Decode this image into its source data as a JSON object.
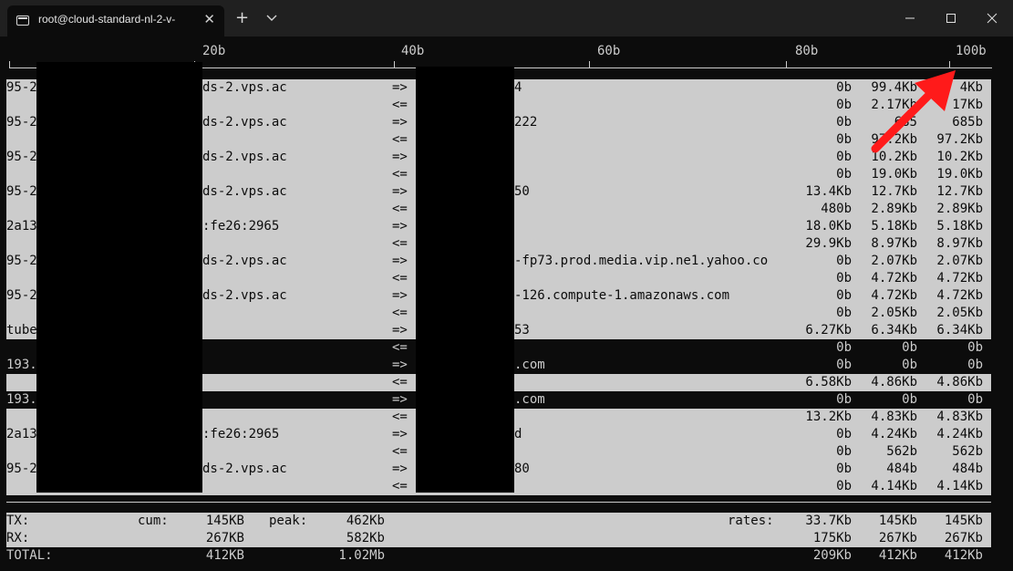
{
  "window": {
    "tab_title": "root@cloud-standard-nl-2-v-",
    "tab_close": "✕",
    "new_tab": "+"
  },
  "scale": {
    "labels": [
      "20b",
      "40b",
      "60b",
      "80b",
      "100b"
    ]
  },
  "connections": [
    {
      "host": "95-2",
      "host_tail": "ds-2.vps.ac",
      "dir": "=>",
      "peer_tail": "4",
      "r1": "0b",
      "r2": "99.4Kb",
      "r3": "4Kb"
    },
    {
      "host": "",
      "host_tail": "",
      "dir": "<=",
      "peer_tail": "",
      "r1": "0b",
      "r2": "2.17Kb",
      "r3": "17Kb"
    },
    {
      "host": "95-2",
      "host_tail": "ds-2.vps.ac",
      "dir": "=>",
      "peer_tail": "222",
      "r1": "0b",
      "r2": "685",
      "r3": "685b"
    },
    {
      "host": "",
      "host_tail": "",
      "dir": "<=",
      "peer_tail": "",
      "r1": "0b",
      "r2": "97.2Kb",
      "r3": "97.2Kb"
    },
    {
      "host": "95-2",
      "host_tail": "ds-2.vps.ac",
      "dir": "=>",
      "peer_tail": "",
      "r1": "0b",
      "r2": "10.2Kb",
      "r3": "10.2Kb"
    },
    {
      "host": "",
      "host_tail": "",
      "dir": "<=",
      "peer_tail": "",
      "r1": "0b",
      "r2": "19.0Kb",
      "r3": "19.0Kb"
    },
    {
      "host": "95-2",
      "host_tail": "ds-2.vps.ac",
      "dir": "=>",
      "peer_tail": "50",
      "r1": "13.4Kb",
      "r2": "12.7Kb",
      "r3": "12.7Kb"
    },
    {
      "host": "",
      "host_tail": "",
      "dir": "<=",
      "peer_tail": "",
      "r1": "480b",
      "r2": "2.89Kb",
      "r3": "2.89Kb"
    },
    {
      "host": "2a13",
      "host_tail": ":fe26:2965",
      "dir": "=>",
      "peer_tail": "",
      "r1": "18.0Kb",
      "r2": "5.18Kb",
      "r3": "5.18Kb"
    },
    {
      "host": "",
      "host_tail": "",
      "dir": "<=",
      "peer_tail": "",
      "r1": "29.9Kb",
      "r2": "8.97Kb",
      "r3": "8.97Kb"
    },
    {
      "host": "95-2",
      "host_tail": "ds-2.vps.ac",
      "dir": "=>",
      "peer_tail": "-fp73.prod.media.vip.ne1.yahoo.co",
      "r1": "0b",
      "r2": "2.07Kb",
      "r3": "2.07Kb"
    },
    {
      "host": "",
      "host_tail": "",
      "dir": "<=",
      "peer_tail": "",
      "r1": "0b",
      "r2": "4.72Kb",
      "r3": "4.72Kb"
    },
    {
      "host": "95-2",
      "host_tail": "ds-2.vps.ac",
      "dir": "=>",
      "peer_tail": "-126.compute-1.amazonaws.com",
      "r1": "0b",
      "r2": "4.72Kb",
      "r3": "4.72Kb"
    },
    {
      "host": "",
      "host_tail": "",
      "dir": "<=",
      "peer_tail": "",
      "r1": "0b",
      "r2": "2.05Kb",
      "r3": "2.05Kb"
    },
    {
      "host": "tube",
      "host_tail": "",
      "dir": "=>",
      "peer_tail": "53",
      "r1": "6.27Kb",
      "r2": "6.34Kb",
      "r3": "6.34Kb"
    },
    {
      "host": "",
      "host_tail": "",
      "dir": "<=",
      "peer_tail": "",
      "r1": "0b",
      "r2": "0b",
      "r3": "0b"
    },
    {
      "host": "193.",
      "host_tail": "",
      "dir": "=>",
      "peer_tail": ".com",
      "r1": "0b",
      "r2": "0b",
      "r3": "0b"
    },
    {
      "host": "",
      "host_tail": "",
      "dir": "<=",
      "peer_tail": "",
      "r1": "6.58Kb",
      "r2": "4.86Kb",
      "r3": "4.86Kb"
    },
    {
      "host": "193.",
      "host_tail": "",
      "dir": "=>",
      "peer_tail": ".com",
      "r1": "0b",
      "r2": "0b",
      "r3": "0b"
    },
    {
      "host": "",
      "host_tail": "",
      "dir": "<=",
      "peer_tail": "",
      "r1": "13.2Kb",
      "r2": "4.83Kb",
      "r3": "4.83Kb"
    },
    {
      "host": "2a13",
      "host_tail": ":fe26:2965",
      "dir": "=>",
      "peer_tail": "d",
      "r1": "0b",
      "r2": "4.24Kb",
      "r3": "4.24Kb"
    },
    {
      "host": "",
      "host_tail": "",
      "dir": "<=",
      "peer_tail": "",
      "r1": "0b",
      "r2": "562b",
      "r3": "562b"
    },
    {
      "host": "95-2",
      "host_tail": "ds-2.vps.ac",
      "dir": "=>",
      "peer_tail": "80",
      "r1": "0b",
      "r2": "484b",
      "r3": "484b"
    },
    {
      "host": "",
      "host_tail": "",
      "dir": "<=",
      "peer_tail": "",
      "r1": "0b",
      "r2": "4.14Kb",
      "r3": "4.14Kb"
    }
  ],
  "bar_fill": [
    1,
    1,
    1,
    1,
    1,
    1,
    1,
    1,
    1,
    1,
    1,
    1,
    1,
    1,
    1,
    0,
    0,
    1,
    0,
    1,
    1,
    1,
    1,
    1
  ],
  "totals": {
    "tx": {
      "label": "TX:",
      "cum_label": "cum:",
      "cum": "145KB",
      "peak_label": "peak:",
      "peak": "462Kb",
      "rates_label": "rates:",
      "r1": "33.7Kb",
      "r2": "145Kb",
      "r3": "145Kb"
    },
    "rx": {
      "label": "RX:",
      "cum": "267KB",
      "peak": "582Kb",
      "r1": "175Kb",
      "r2": "267Kb",
      "r3": "267Kb"
    },
    "total": {
      "label": "TOTAL:",
      "cum": "412KB",
      "peak": "1.02Mb",
      "r1": "209Kb",
      "r2": "412Kb",
      "r3": "412Kb"
    }
  },
  "colors": {
    "terminal_bg": "#0c0c0c",
    "text": "#cccccc",
    "bar": "#cccccc",
    "annotation_arrow": "#ff1a1a"
  }
}
